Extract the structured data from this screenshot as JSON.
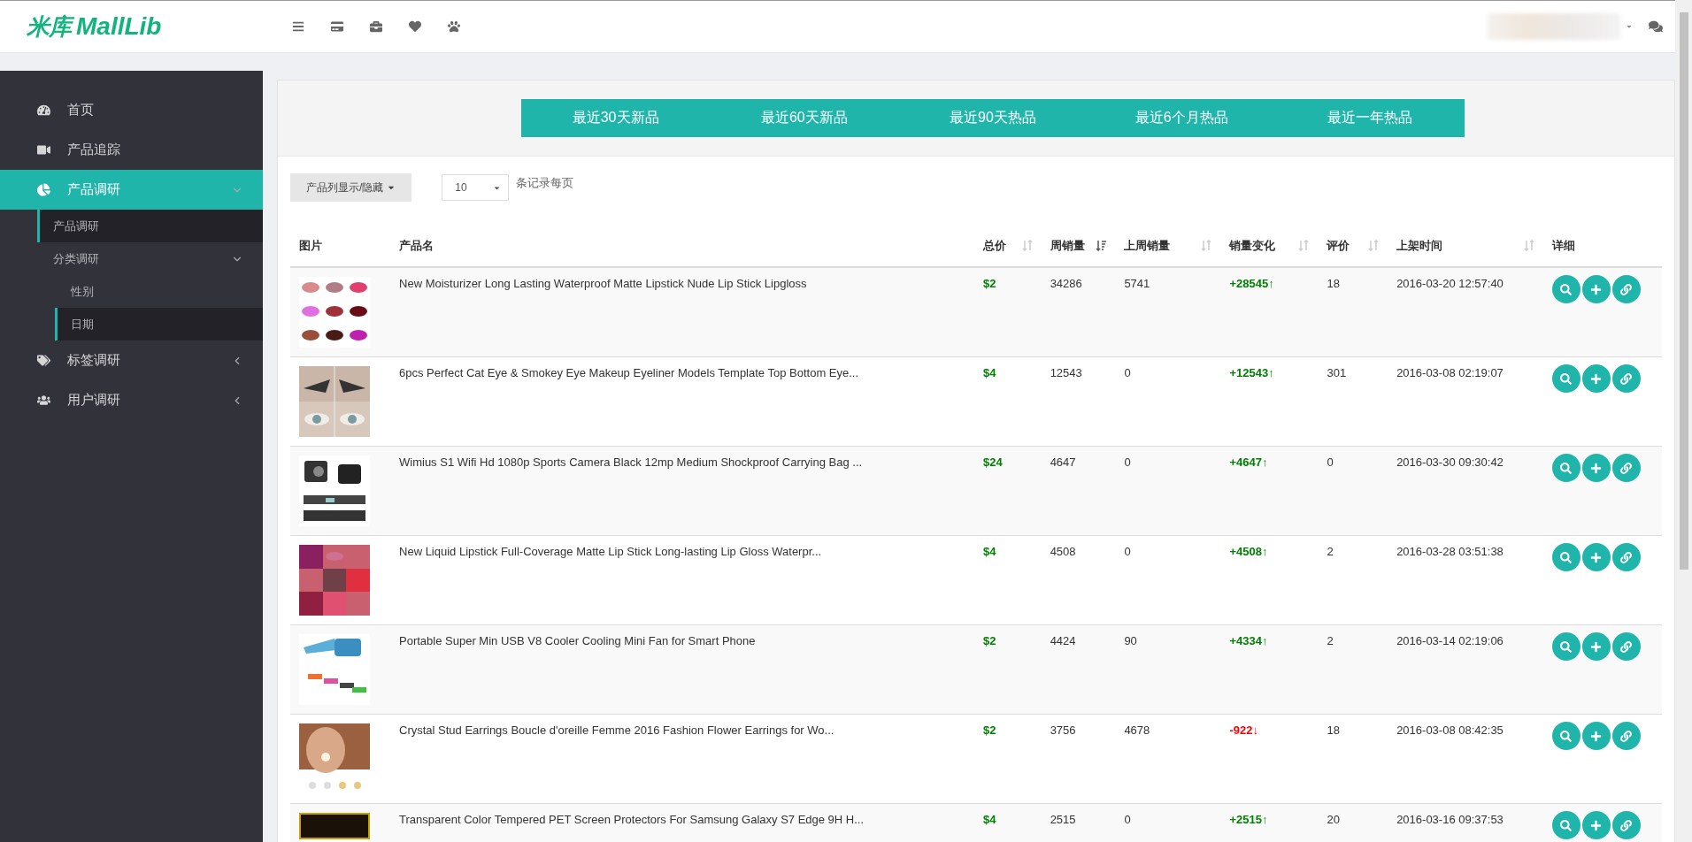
{
  "header": {
    "logo_cn": "米库",
    "logo_en": "MallLib"
  },
  "sidebar": {
    "items": [
      {
        "label": "首页",
        "selected": false
      },
      {
        "label": "产品追踪",
        "selected": false
      },
      {
        "label": "产品调研",
        "selected": true,
        "expanded": true,
        "children": [
          {
            "label": "产品调研",
            "selected": true
          },
          {
            "label": "分类调研",
            "selected": false,
            "expanded": true,
            "children": [
              {
                "label": "性别",
                "selected": false
              },
              {
                "label": "日期",
                "selected": true
              }
            ]
          }
        ]
      },
      {
        "label": "标签调研",
        "selected": false,
        "expanded": false
      },
      {
        "label": "用户调研",
        "selected": false,
        "expanded": false
      }
    ]
  },
  "period_tabs": [
    "最近30天新品",
    "最近60天新品",
    "最近90天热品",
    "最近6个月热品",
    "最近一年热品"
  ],
  "toolbar": {
    "columns_button": "产品列显示/隐藏",
    "page_size": "10",
    "page_size_suffix": "条记录每页"
  },
  "table": {
    "columns": [
      {
        "label": "图片"
      },
      {
        "label": "产品名"
      },
      {
        "label": "总价",
        "sorted": false
      },
      {
        "label": "周销量",
        "sorted": true
      },
      {
        "label": "上周销量",
        "sorted": false
      },
      {
        "label": "销量变化",
        "sorted": false
      },
      {
        "label": "评价",
        "sorted": false
      },
      {
        "label": "上架时间",
        "sorted": false
      },
      {
        "label": "详细"
      }
    ],
    "rows": [
      {
        "name": "New Moisturizer Long Lasting Waterproof Matte Lipstick Nude Lip Stick Lipgloss",
        "price": "$2",
        "weekly_sales": "34286",
        "last_week_sales": "5741",
        "change": "+28545↑",
        "rising": true,
        "rating": "18",
        "listed": "2016-03-20 12:57:40"
      },
      {
        "name": "6pcs Perfect Cat Eye & Smokey Eye Makeup Eyeliner Models Template Top Bottom Eye...",
        "price": "$4",
        "weekly_sales": "12543",
        "last_week_sales": "0",
        "change": "+12543↑",
        "rising": true,
        "rating": "301",
        "listed": "2016-03-08 02:19:07"
      },
      {
        "name": "Wimius S1 Wifi Hd 1080p Sports Camera Black 12mp Medium Shockproof Carrying Bag ...",
        "price": "$24",
        "weekly_sales": "4647",
        "last_week_sales": "0",
        "change": "+4647↑",
        "rising": true,
        "rating": "0",
        "listed": "2016-03-30 09:30:42"
      },
      {
        "name": "New Liquid Lipstick Full-Coverage Matte Lip Stick Long-lasting Lip Gloss Waterpr...",
        "price": "$4",
        "weekly_sales": "4508",
        "last_week_sales": "0",
        "change": "+4508↑",
        "rising": true,
        "rating": "2",
        "listed": "2016-03-28 03:51:38"
      },
      {
        "name": "Portable Super Min USB V8 Cooler Cooling Mini Fan for Smart Phone",
        "price": "$2",
        "weekly_sales": "4424",
        "last_week_sales": "90",
        "change": "+4334↑",
        "rising": true,
        "rating": "2",
        "listed": "2016-03-14 02:19:06"
      },
      {
        "name": "Crystal Stud Earrings Boucle d'oreille Femme 2016 Fashion Flower Earrings for Wo...",
        "price": "$2",
        "weekly_sales": "3756",
        "last_week_sales": "4678",
        "change": "-922↓",
        "rising": false,
        "rating": "18",
        "listed": "2016-03-08 08:42:35"
      },
      {
        "name": "Transparent Color Tempered PET Screen Protectors For Samsung Galaxy S7 Edge 9H H...",
        "price": "$4",
        "weekly_sales": "2515",
        "last_week_sales": "0",
        "change": "+2515↑",
        "rising": true,
        "rating": "20",
        "listed": "2016-03-16 09:37:53"
      }
    ]
  }
}
